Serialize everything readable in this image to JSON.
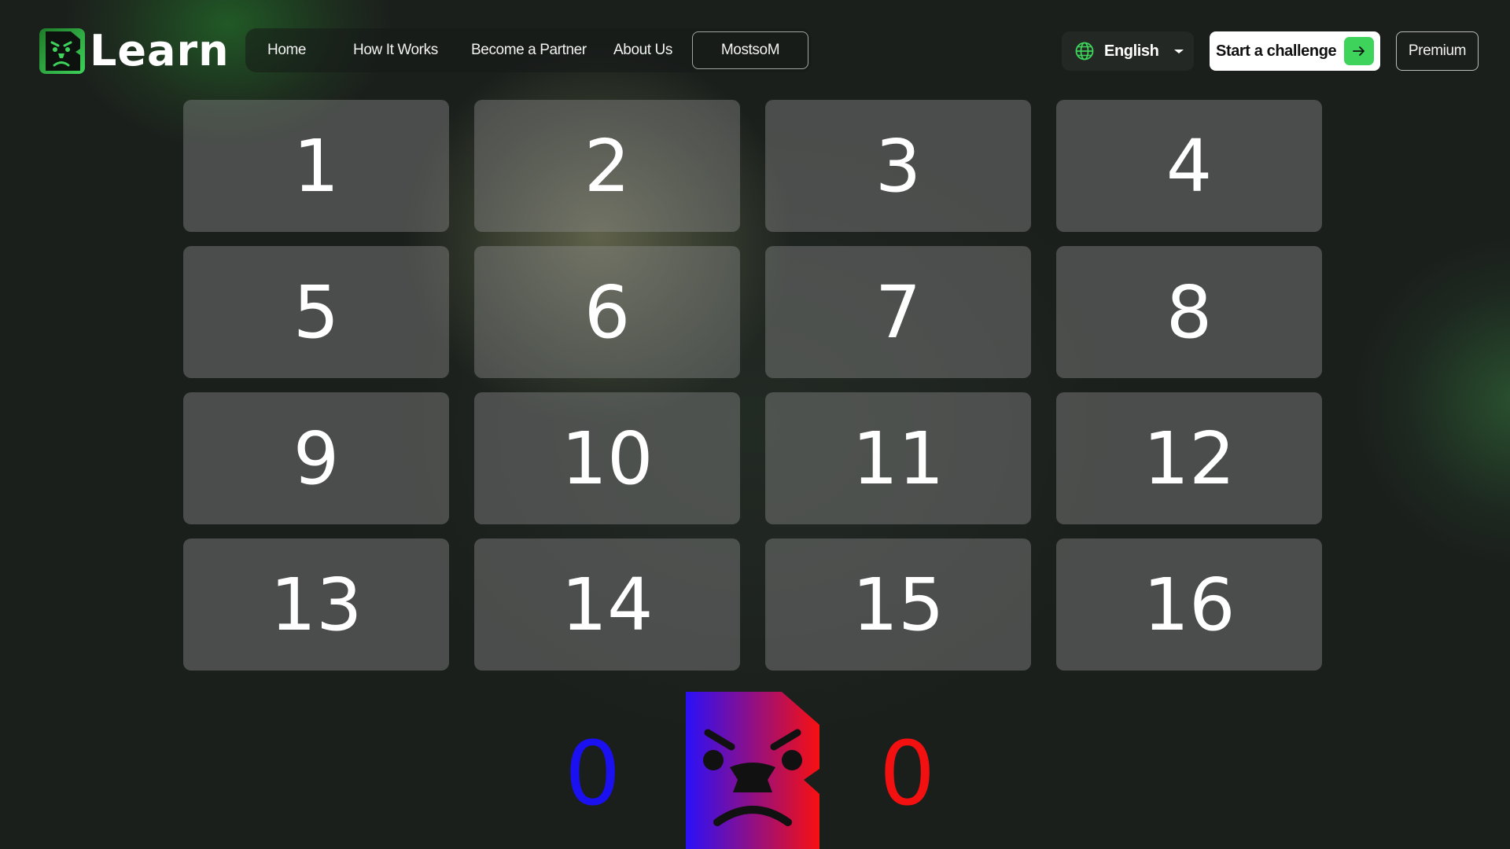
{
  "brand": {
    "name": "Learn",
    "logo_icon": "angry-face-logo-icon",
    "accent_color": "#3ed35a"
  },
  "nav": {
    "links": [
      "Home",
      "How It Works",
      "Become a Partner",
      "About Us"
    ],
    "user": "MostsoM"
  },
  "language": {
    "selected": "English",
    "icon": "globe-icon"
  },
  "actions": {
    "start_challenge": "Start a challenge",
    "premium": "Premium"
  },
  "board": {
    "tiles": [
      "1",
      "2",
      "3",
      "4",
      "5",
      "6",
      "7",
      "8",
      "9",
      "10",
      "11",
      "12",
      "13",
      "14",
      "15",
      "16"
    ]
  },
  "score": {
    "blue": "0",
    "red": "0",
    "blue_color": "#1a10f0",
    "red_color": "#f21010",
    "mascot_icon": "angry-face-mascot-icon"
  }
}
